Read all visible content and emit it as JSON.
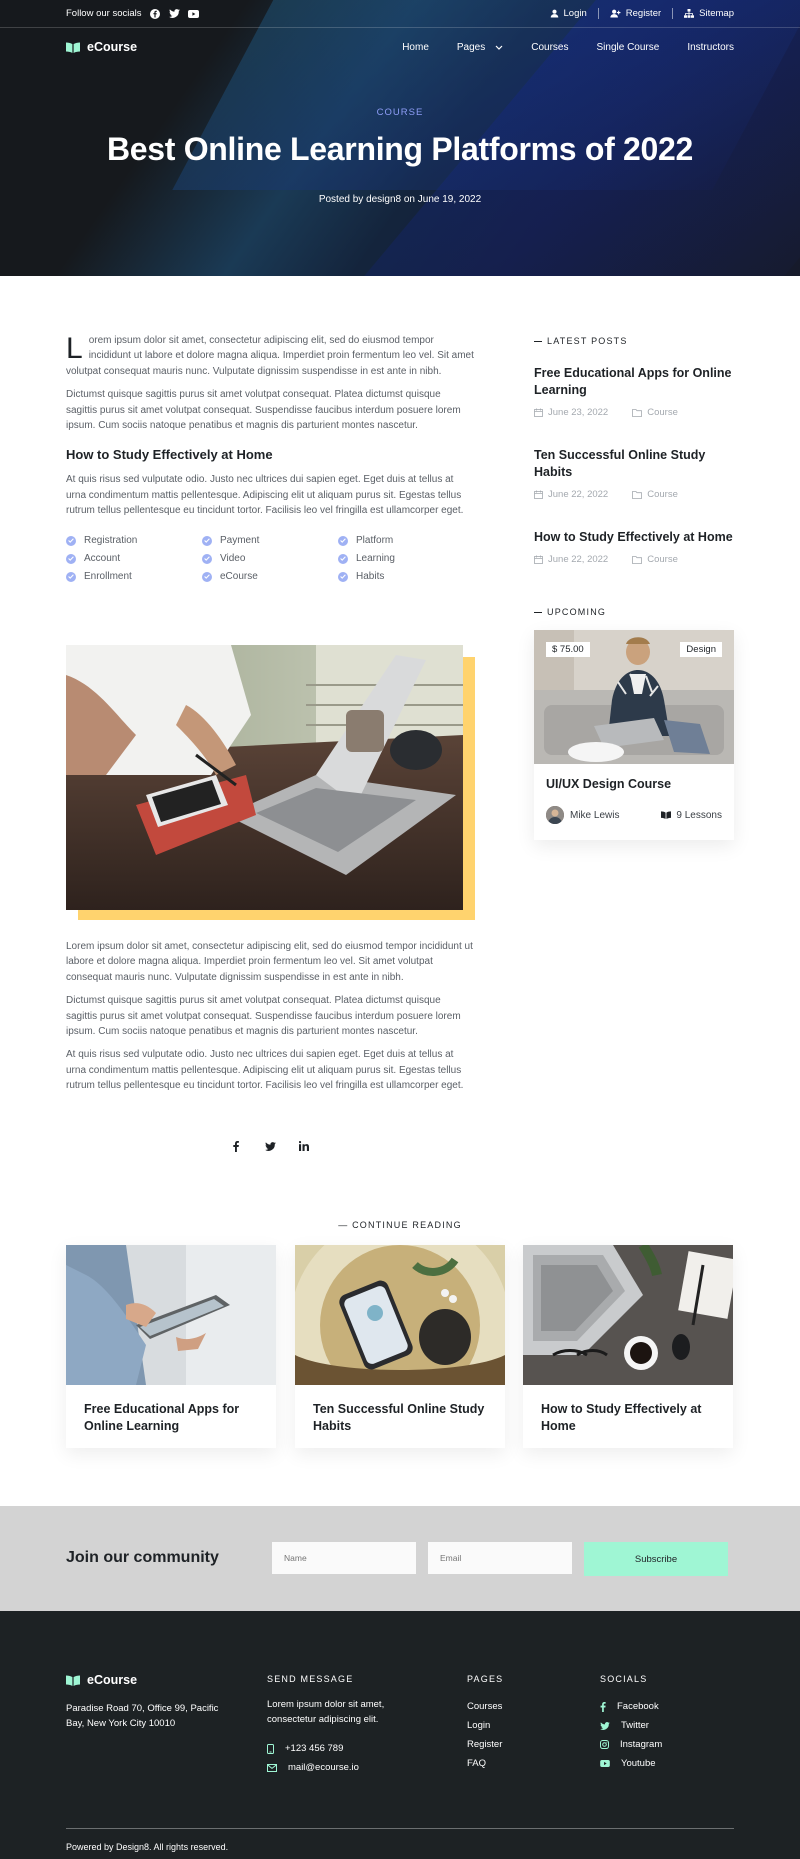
{
  "topbar": {
    "follow_label": "Follow our socials",
    "login": "Login",
    "register": "Register",
    "sitemap": "Sitemap"
  },
  "nav": {
    "brand": "eCourse",
    "items": [
      "Home",
      "Pages",
      "Courses",
      "Single Course",
      "Instructors"
    ]
  },
  "hero": {
    "category": "COURSE",
    "title": "Best Online Learning Platforms of 2022",
    "meta": "Posted by design8 on June 19, 2022"
  },
  "article": {
    "dropcap": "L",
    "p1": "orem ipsum dolor sit amet, consectetur adipiscing elit, sed do eiusmod tempor incididunt ut labore et dolore magna aliqua. Imperdiet proin fermentum leo vel. Sit amet volutpat consequat mauris nunc. Vulputate dignissim suspendisse in est ante in nibh.",
    "p2": "Dictumst quisque sagittis purus sit amet volutpat consequat. Platea dictumst quisque sagittis purus sit amet volutpat consequat. Suspendisse faucibus interdum posuere lorem ipsum. Cum sociis natoque penatibus et magnis dis parturient montes nascetur.",
    "heading": "How to Study Effectively at Home",
    "p3": "At quis risus sed vulputate odio. Justo nec ultrices dui sapien eget. Eget duis at tellus at urna condimentum mattis pellentesque. Adipiscing elit ut aliquam purus sit. Egestas tellus rutrum tellus pellentesque eu tincidunt tortor. Facilisis leo vel fringilla est ullamcorper eget.",
    "checklist": [
      "Registration",
      "Payment",
      "Platform",
      "Account",
      "Video",
      "Learning",
      "Enrollment",
      "eCourse",
      "Habits"
    ],
    "p4": "Lorem ipsum dolor sit amet, consectetur adipiscing elit, sed do eiusmod tempor incididunt ut labore et dolore magna aliqua. Imperdiet proin fermentum leo vel. Sit amet volutpat consequat mauris nunc. Vulputate dignissim suspendisse in est ante in nibh.",
    "p5": "Dictumst quisque sagittis purus sit amet volutpat consequat. Platea dictumst quisque sagittis purus sit amet volutpat consequat. Suspendisse faucibus interdum posuere lorem ipsum. Cum sociis natoque penatibus et magnis dis parturient montes nascetur.",
    "p6": "At quis risus sed vulputate odio. Justo nec ultrices dui sapien eget. Eget duis at tellus at urna condimentum mattis pellentesque. Adipiscing elit ut aliquam purus sit. Egestas tellus rutrum tellus pellentesque eu tincidunt tortor. Facilisis leo vel fringilla est ullamcorper eget."
  },
  "sidebar": {
    "latest_heading": "LATEST POSTS",
    "posts": [
      {
        "title": "Free Educational Apps for Online Learning",
        "date": "June 23, 2022",
        "category": "Course"
      },
      {
        "title": "Ten Successful Online Study Habits",
        "date": "June 22, 2022",
        "category": "Course"
      },
      {
        "title": "How to Study Effectively at Home",
        "date": "June 22, 2022",
        "category": "Course"
      }
    ],
    "upcoming_heading": "UPCOMING",
    "course": {
      "price": "$ 75.00",
      "tag": "Design",
      "title": "UI/UX Design Course",
      "author": "Mike Lewis",
      "lessons": "9 Lessons"
    }
  },
  "continue": {
    "heading": "CONTINUE READING",
    "cards": [
      {
        "title": "Free Educational Apps for Online Learning"
      },
      {
        "title": "Ten Successful Online Study Habits"
      },
      {
        "title": "How to Study Effectively at Home"
      }
    ]
  },
  "newsletter": {
    "heading": "Join our community",
    "name_placeholder": "Name",
    "email_placeholder": "Email",
    "button": "Subscribe"
  },
  "footer": {
    "brand": "eCourse",
    "address": "Paradise Road 70, Office 99, Pacific Bay,  New York City 10010",
    "send_heading": "SEND MESSAGE",
    "send_text": "Lorem ipsum dolor sit amet, consectetur adipiscing elit.",
    "phone": "+123 456 789",
    "email": "mail@ecourse.io",
    "pages_heading": "PAGES",
    "pages": [
      "Courses",
      "Login",
      "Register",
      "FAQ"
    ],
    "socials_heading": "SOCIALS",
    "socials": [
      "Facebook",
      "Twitter",
      "Instagram",
      "Youtube"
    ],
    "copyright": "Powered by Design8. All rights reserved."
  },
  "colors": {
    "accent": "#8e9df7",
    "check": "#9fb1f4",
    "social_icon": "#9ff6d4",
    "subscribe": "#9ff6d4",
    "figure_shadow": "#ffd36e",
    "footer_bg": "#1d2224"
  }
}
